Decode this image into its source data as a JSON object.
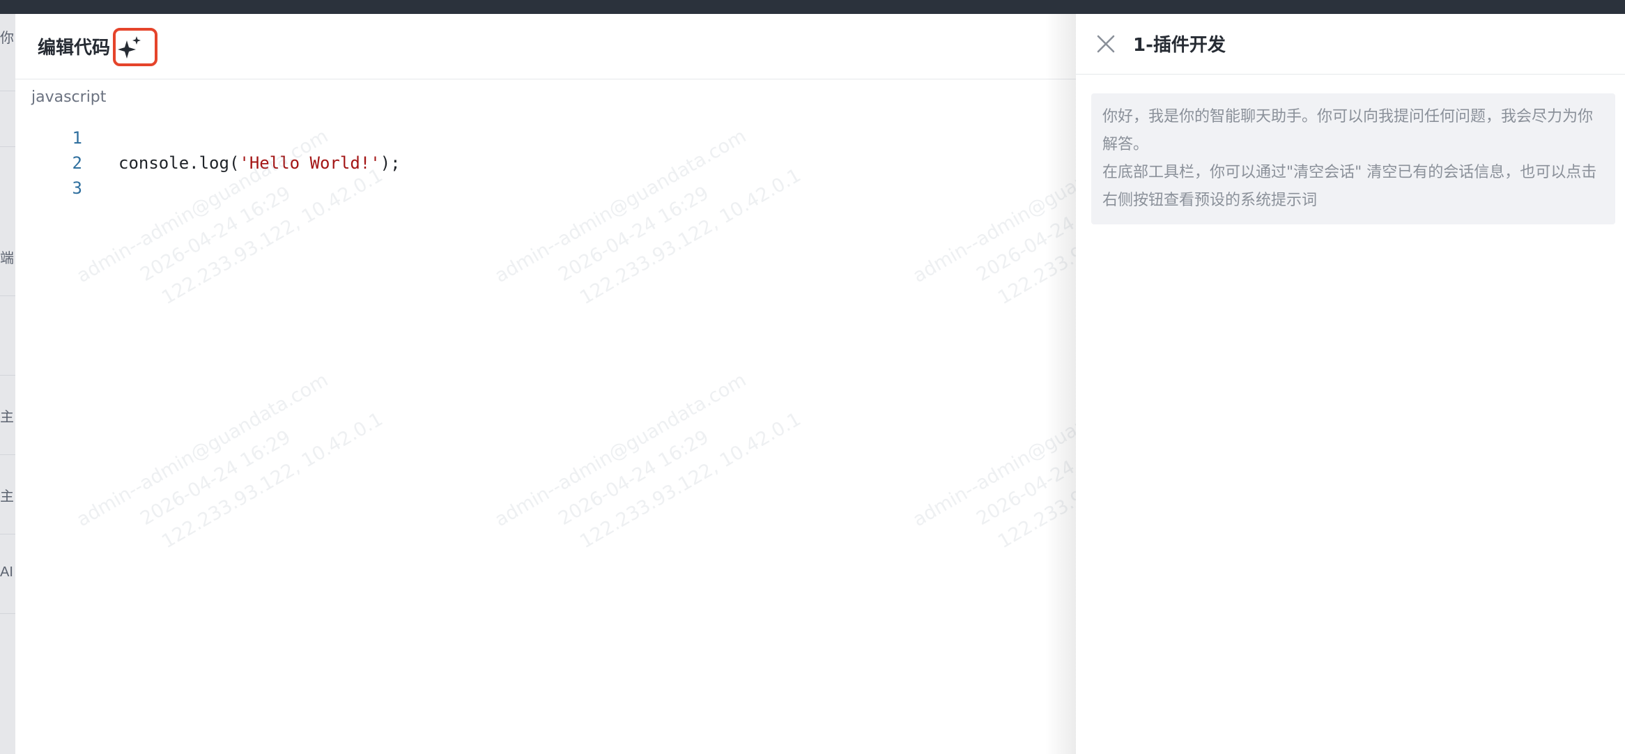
{
  "background_page": {
    "side_labels": [
      "你",
      "端",
      "主",
      "主",
      "AI"
    ]
  },
  "editor": {
    "title": "编辑代码",
    "ai_button_icon": "sparkle-icon",
    "language": "javascript",
    "lines": [
      {
        "number": "1",
        "code": ""
      },
      {
        "number": "2",
        "code_prefix": "console.log(",
        "code_string": "'Hello World!'",
        "code_suffix": ");"
      },
      {
        "number": "3",
        "code": ""
      }
    ]
  },
  "watermark": {
    "line1": "admin--admin@guandata.com",
    "line2": "2026-04-24 16:29",
    "line3": "122.233.93.122, 10.42.0.1"
  },
  "chat": {
    "close_icon": "close-icon",
    "title": "1-插件开发",
    "welcome_line1": "你好，我是你的智能聊天助手。你可以向我提问任何问题，我会尽力为你解答。",
    "welcome_line2": "在底部工具栏，你可以通过\"清空会话\" 清空已有的会话信息，也可以点击右侧按钮查看预设的系统提示词"
  },
  "colors": {
    "accent_highlight": "#e5442b",
    "string_token": "#a31515",
    "line_number": "#2f6f9e"
  }
}
